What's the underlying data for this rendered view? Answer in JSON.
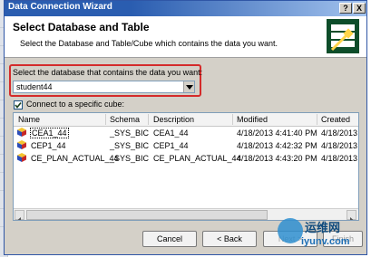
{
  "window": {
    "title": "Data Connection Wizard"
  },
  "titlebar": {
    "help_label": "?",
    "close_label": "X"
  },
  "header": {
    "title": "Select Database and Table",
    "subtitle": "Select the Database and Table/Cube which contains the data you want."
  },
  "database": {
    "label": "Select the database that contains the data you want:",
    "selected": "student44"
  },
  "cube_checkbox": {
    "label": "Connect to a specific cube:",
    "checked": true
  },
  "table": {
    "columns": [
      "Name",
      "Schema",
      "Description",
      "Modified",
      "Created"
    ],
    "rows": [
      {
        "name": "CEA1_44",
        "schema": "_SYS_BIC",
        "description": "CEA1_44",
        "modified": "4/18/2013 4:41:40 PM",
        "created": "4/18/2013 4",
        "selected": true
      },
      {
        "name": "CEP1_44",
        "schema": "_SYS_BIC",
        "description": "CEP1_44",
        "modified": "4/18/2013 4:42:32 PM",
        "created": "4/18/2013 4",
        "selected": false
      },
      {
        "name": "CE_PLAN_ACTUAL_44",
        "schema": "_SYS_BIC",
        "description": "CE_PLAN_ACTUAL_44",
        "modified": "4/18/2013 4:43:20 PM",
        "created": "4/18/2013 4",
        "selected": false
      }
    ]
  },
  "buttons": {
    "cancel": "Cancel",
    "back": "< Back",
    "next": "Next >",
    "finish": "Finish"
  },
  "watermark": {
    "cn": "运维网",
    "en": "iyunv.com"
  },
  "colors": {
    "title_bar": "#2a5db0",
    "highlight_box": "#d42b2b",
    "wizard_icon_bg": "#0d4d2a"
  }
}
